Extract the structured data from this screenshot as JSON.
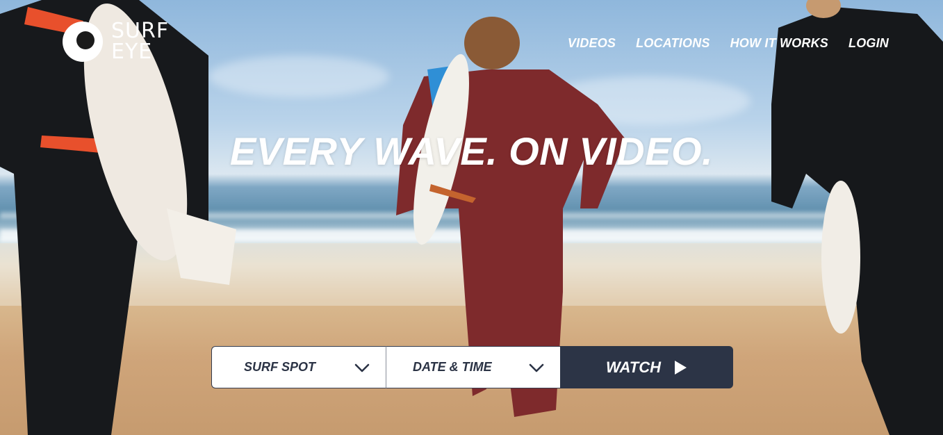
{
  "brand": {
    "line1": "SURF",
    "line2": "EYE",
    "logo_icon": "eye-icon"
  },
  "nav": [
    {
      "label": "VIDEOS"
    },
    {
      "label": "LOCATIONS"
    },
    {
      "label": "HOW IT WORKS"
    },
    {
      "label": "LOGIN"
    }
  ],
  "hero": {
    "headline": "EVERY WAVE. ON VIDEO."
  },
  "search": {
    "spot_label": "SURF SPOT",
    "datetime_label": "DATE & TIME",
    "watch_label": "WATCH",
    "dropdown_icon": "chevron-down-icon",
    "watch_icon": "play-icon"
  },
  "colors": {
    "accent": "#2c3446",
    "text_on_image": "#ffffff",
    "wetsuit_red": "#7e2a2c",
    "wetsuit_black": "#1a1c1f",
    "stripe_orange": "#e8502c"
  }
}
